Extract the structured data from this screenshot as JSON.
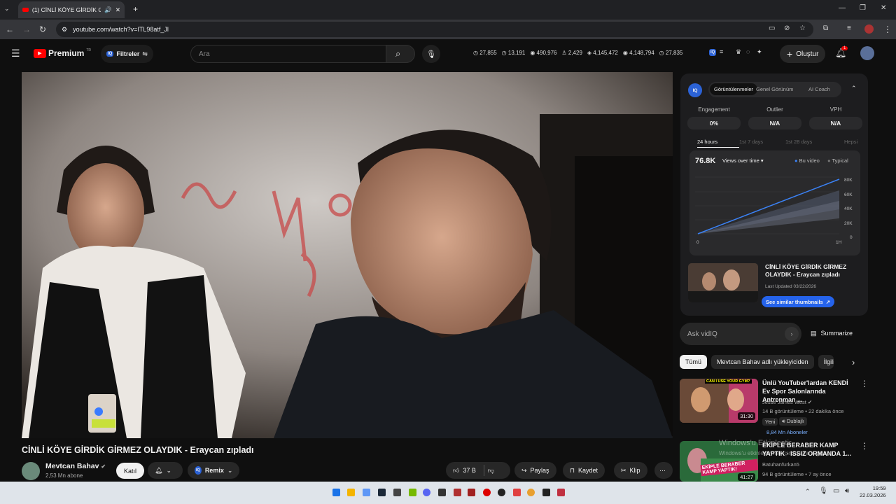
{
  "browser": {
    "tab_title": "(1) CİNLİ KÖYE GİRDİK GİRMEZ OLAYDIK - Eraycan zıpladı",
    "url": "youtube.com/watch?v=ITL98atf_Jl"
  },
  "header": {
    "logo_text": "Premium",
    "logo_badge": "TR",
    "filters_label": "Filtreler",
    "search_placeholder": "Ara",
    "create_label": "Oluştur",
    "notif_count": "1",
    "stats": [
      "27,855",
      "13,191",
      "490,976",
      "2,429",
      "4,145,472",
      "4,148,794",
      "27,835"
    ]
  },
  "vidiq": {
    "tabs": [
      "Görüntülenmeler",
      "Genel Görünüm",
      "AI Coach"
    ],
    "metrics": [
      {
        "label": "Engagement",
        "value": "0%"
      },
      {
        "label": "Outlier",
        "value": "N/A"
      },
      {
        "label": "VPH",
        "value": "N/A"
      }
    ],
    "ranges": [
      "24 hours",
      "1st 7 days",
      "1st 28 days",
      "Hepsi"
    ],
    "chart_value": "76.8K",
    "chart_select": "Views over time",
    "legend": [
      "Bu video",
      "Typical"
    ],
    "y_ticks": [
      "80K",
      "60K",
      "40K",
      "20K",
      "0"
    ],
    "x_ticks": [
      "0",
      "1H"
    ],
    "video_title": "CİNLİ KÖYE GİRDİK GİRMEZ OLAYDIK - Eraycan zıpladı",
    "last_updated": "Last Updated 03/22/2026",
    "similar_btn": "See similar thumbnails",
    "ask_placeholder": "Ask vidIQ",
    "summarize": "Summarize"
  },
  "chips": [
    "Tümü",
    "Mevtcan Bahav adlı yükleyiciden",
    "İlgili"
  ],
  "recs": [
    {
      "title": "Ünlü YouTuber'lardan KENDİ Ev Spor Salonlarında Antrenman ...",
      "channel": "Jesse James West",
      "meta": "14 B görüntüleme • 22 dakika önce",
      "badge1": "Yeni",
      "badge2": "Dublajlı",
      "subs": "8,84 Mn Aboneler",
      "duration": "31:30",
      "thumb_text": "CAN I USE YOUR GYM?"
    },
    {
      "title": "EKİPLE BERABER KAMP YAPTIK - ISSIZ ORMANDA 1...",
      "channel": "Batuhanfurkan5",
      "meta": "94 B görüntüleme • 7 ay önce",
      "duration": "41:27",
      "thumb_text": "EKİPLE BERABER KAMP YAPTIK!"
    }
  ],
  "watermark": {
    "line1": "Windows'u Etkinleştir",
    "line2": "Windows'u etkinleştirmek için Ayarlar'a gidin."
  },
  "video": {
    "title": "CİNLİ KÖYE GİRDİK GİRMEZ OLAYDIK - Eraycan zıpladı",
    "channel": "Mevtcan Bahav",
    "subs": "2,53 Mn abone",
    "join": "Katıl",
    "remix": "Remix",
    "likes": "37 B",
    "share": "Paylaş",
    "save": "Kaydet",
    "clip": "Klip"
  },
  "clock": {
    "time": "19:59",
    "date": "22.03.2026"
  }
}
